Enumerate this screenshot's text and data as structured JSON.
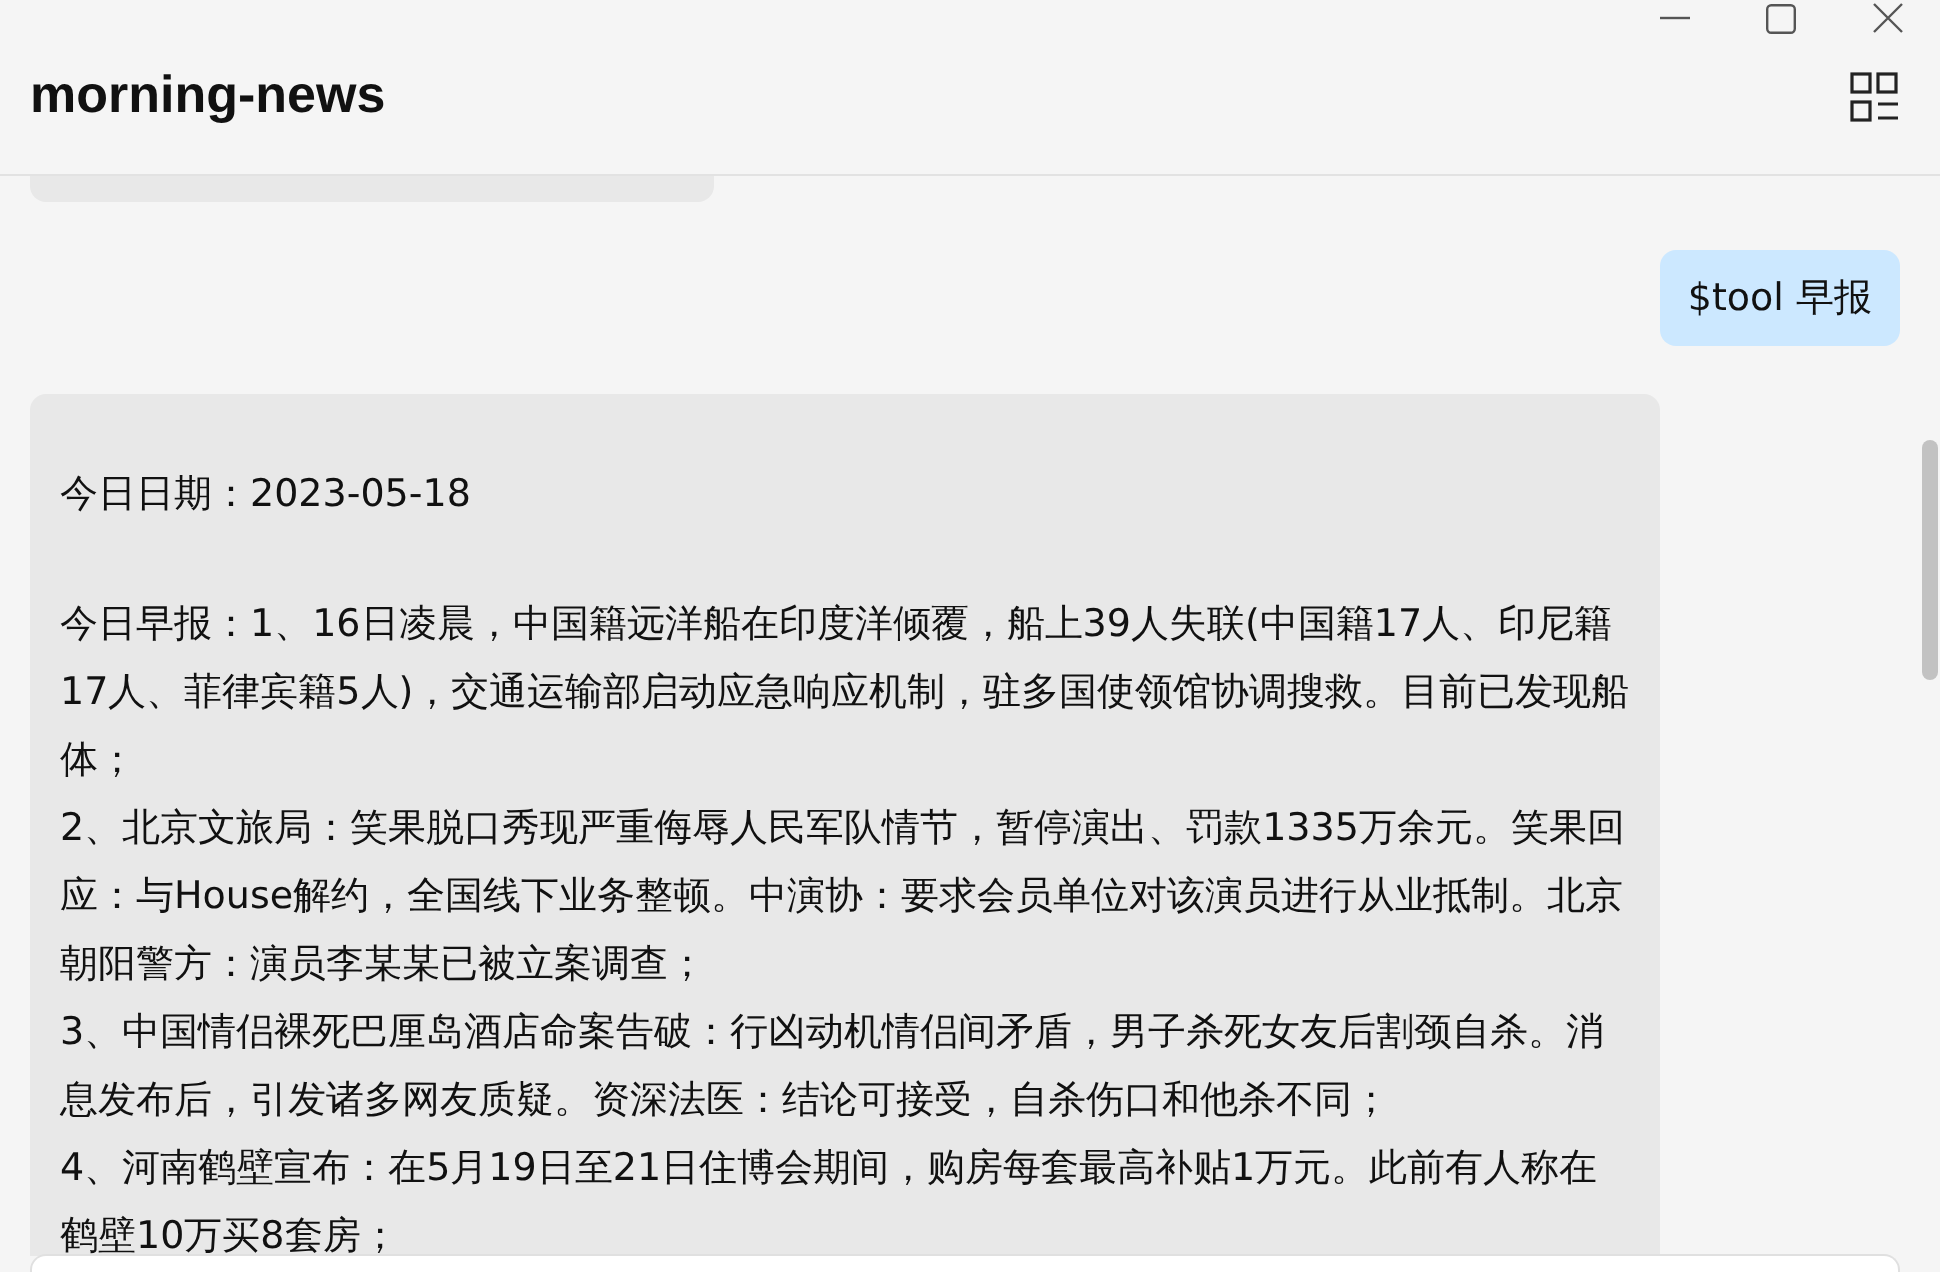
{
  "window": {
    "title": "morning-news"
  },
  "messages": [
    {
      "kind": "cut"
    },
    {
      "kind": "sent",
      "paragraphs": [
        "$tool 早报"
      ]
    },
    {
      "kind": "received",
      "paragraphs": [
        "今日日期：2023-05-18",
        "今日早报：1、16日凌晨，中国籍远洋船在印度洋倾覆，船上39人失联(中国籍17人、印尼籍17人、菲律宾籍5人)，交通运输部启动应急响应机制，驻多国使领馆协调搜救。目前已发现船体；",
        "2、北京文旅局：笑果脱口秀现严重侮辱人民军队情节，暂停演出、罚款1335万余元。笑果回应：与House解约，全国线下业务整顿。中演协：要求会员单位对该演员进行从业抵制。北京朝阳警方：演员李某某已被立案调查；",
        "3、中国情侣裸死巴厘岛酒店命案告破：行凶动机情侣间矛盾，男子杀死女友后割颈自杀。消息发布后，引发诸多网友质疑。资深法医：结论可接受，自杀伤口和他杀不同；",
        "4、河南鹤壁宣布：在5月19日至21日住博会期间，购房每套最高补贴1万元。此前有人称在鹤壁10万买8套房；"
      ]
    }
  ]
}
